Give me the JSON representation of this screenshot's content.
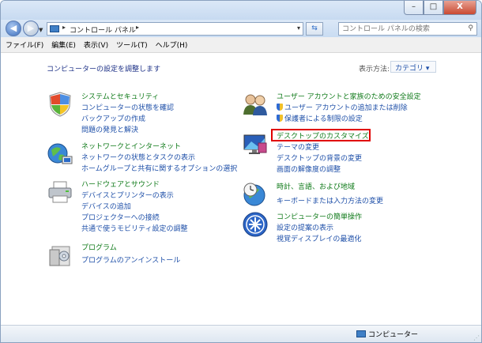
{
  "window": {
    "close_label": "X",
    "min_label": "–",
    "max_label": "□"
  },
  "nav": {
    "breadcrumb": "コントロール パネル",
    "search_placeholder": "コントロール パネルの検索"
  },
  "menu": [
    "ファイル(F)",
    "編集(E)",
    "表示(V)",
    "ツール(T)",
    "ヘルプ(H)"
  ],
  "content": {
    "heading": "コンピューターの設定を調整します",
    "view_by_label": "表示方法:",
    "view_by_value": "カテゴリ ▾"
  },
  "left_categories": [
    {
      "title": "システムとセキュリティ",
      "icon": "shield-icon",
      "links": [
        "コンピューターの状態を確認",
        "バックアップの作成",
        "問題の発見と解決"
      ]
    },
    {
      "title": "ネットワークとインターネット",
      "icon": "network-globe-icon",
      "links": [
        "ネットワークの状態とタスクの表示",
        "ホームグループと共有に関するオプションの選択"
      ]
    },
    {
      "title": "ハードウェアとサウンド",
      "icon": "printer-icon",
      "links": [
        "デバイスとプリンターの表示",
        "デバイスの追加",
        "プロジェクターへの接続",
        "共通で使うモビリティ設定の調整"
      ]
    },
    {
      "title": "プログラム",
      "icon": "programs-icon",
      "links": [
        "プログラムのアンインストール"
      ]
    }
  ],
  "right_categories": [
    {
      "title": "ユーザー アカウントと家族のための安全設定",
      "icon": "users-icon",
      "links": [
        "ユーザー アカウントの追加または削除",
        "保護者による制限の設定"
      ]
    },
    {
      "title": "デスクトップのカスタマイズ",
      "icon": "desktop-icon",
      "links": [
        "テーマの変更",
        "デスクトップの背景の変更",
        "画面の解像度の調整"
      ]
    },
    {
      "title": "時計、言語、および地域",
      "icon": "clock-globe-icon",
      "links": [
        "キーボードまたは入力方法の変更"
      ]
    },
    {
      "title": "コンピューターの簡単操作",
      "icon": "ease-of-access-icon",
      "links": [
        "設定の提案の表示",
        "視覚ディスプレイの最適化"
      ]
    }
  ],
  "status": {
    "label": "コンピューター"
  }
}
